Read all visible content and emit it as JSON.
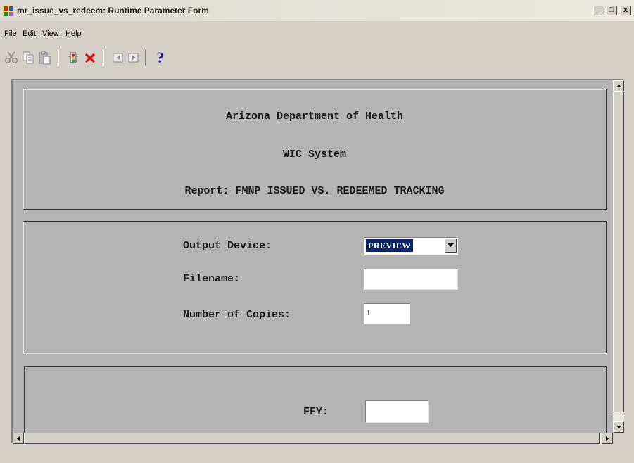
{
  "window": {
    "title": "mr_issue_vs_redeem: Runtime Parameter Form",
    "controls": {
      "minimize": "_",
      "maximize": "□",
      "close": "x"
    }
  },
  "menu": {
    "items": [
      {
        "label": "File",
        "mnemonic": "F",
        "rest": "ile"
      },
      {
        "label": "Edit",
        "mnemonic": "E",
        "rest": "dit"
      },
      {
        "label": "View",
        "mnemonic": "V",
        "rest": "iew"
      },
      {
        "label": "Help",
        "mnemonic": "H",
        "rest": "elp"
      }
    ]
  },
  "toolbar": {
    "icons": [
      "cut-icon",
      "copy-icon",
      "paste-icon",
      "run-report-icon",
      "cancel-icon",
      "previous-page-icon",
      "next-page-icon",
      "help-icon"
    ],
    "help_glyph": "?"
  },
  "header": {
    "line1": "Arizona Department of Health",
    "line2": "WIC System",
    "line3": "Report: FMNP ISSUED VS. REDEEMED TRACKING"
  },
  "output": {
    "device_label": "Output Device:",
    "device_value": "PREVIEW",
    "filename_label": "Filename:",
    "filename_value": "",
    "copies_label": "Number of Copies:",
    "copies_value": "1"
  },
  "params": {
    "ffy_label": "FFY:",
    "ffy_value": ""
  },
  "colors": {
    "canvas": "#b4b4b4",
    "selection": "#0a246a",
    "cancel_red": "#e01010",
    "help_blue": "#1a1aa0"
  }
}
